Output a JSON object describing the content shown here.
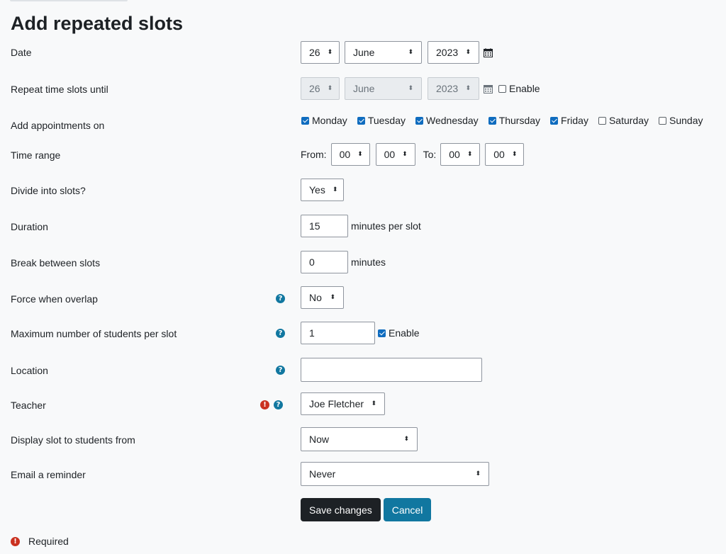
{
  "page_title": "Add repeated slots",
  "date": {
    "label": "Date",
    "day": "26",
    "month": "June",
    "year": "2023"
  },
  "repeat_until": {
    "label": "Repeat time slots until",
    "day": "26",
    "month": "June",
    "year": "2023",
    "enable_label": "Enable"
  },
  "appointments_on": {
    "label": "Add appointments on",
    "days": [
      {
        "label": "Monday",
        "checked": true
      },
      {
        "label": "Tuesday",
        "checked": true
      },
      {
        "label": "Wednesday",
        "checked": true
      },
      {
        "label": "Thursday",
        "checked": true
      },
      {
        "label": "Friday",
        "checked": true
      },
      {
        "label": "Saturday",
        "checked": false
      },
      {
        "label": "Sunday",
        "checked": false
      }
    ]
  },
  "time_range": {
    "label": "Time range",
    "from_label": "From:",
    "from_hour": "00",
    "from_minute": "00",
    "to_label": "To:",
    "to_hour": "00",
    "to_minute": "00"
  },
  "divide": {
    "label": "Divide into slots?",
    "value": "Yes"
  },
  "duration": {
    "label": "Duration",
    "value": "15",
    "suffix": "minutes per slot"
  },
  "break": {
    "label": "Break between slots",
    "value": "0",
    "suffix": "minutes"
  },
  "force_overlap": {
    "label": "Force when overlap",
    "value": "No"
  },
  "max_students": {
    "label": "Maximum number of students per slot",
    "value": "1",
    "enable_label": "Enable"
  },
  "location": {
    "label": "Location",
    "value": ""
  },
  "teacher": {
    "label": "Teacher",
    "value": "Joe Fletcher"
  },
  "display_from": {
    "label": "Display slot to students from",
    "value": "Now"
  },
  "email_reminder": {
    "label": "Email a reminder",
    "value": "Never"
  },
  "buttons": {
    "save": "Save changes",
    "cancel": "Cancel"
  },
  "required_note": "Required",
  "colors": {
    "accent": "#1177a0",
    "primary_check": "#0f6cbf",
    "required": "#ca3120",
    "dark_button": "#1d2125"
  }
}
